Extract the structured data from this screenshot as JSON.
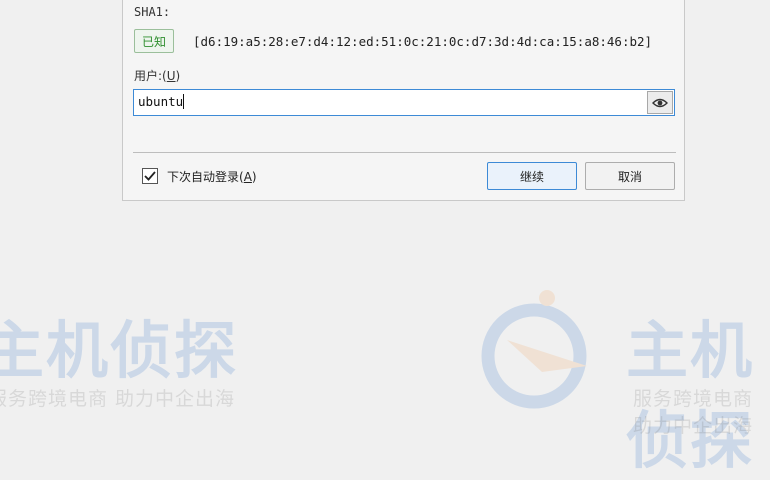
{
  "dialog": {
    "sha1_label": "SHA1:",
    "known_badge": "已知",
    "fingerprint": "[d6:19:a5:28:e7:d4:12:ed:51:0c:21:0c:d7:3d:4d:ca:15:a8:46:b2]",
    "user_label_prefix": "用户:(",
    "user_label_key": "U",
    "user_label_suffix": ")",
    "username_value": "ubuntu",
    "auto_login_prefix": "下次自动登录(",
    "auto_login_key": "A",
    "auto_login_suffix": ")",
    "auto_login_checked": true,
    "continue_button": "继续",
    "cancel_button": "取消"
  },
  "watermark": {
    "brand": "主机侦探",
    "slogan": "服务跨境电商 助力中企出海"
  },
  "colors": {
    "accent": "#3d8ad6",
    "known_green": "#2f8f2f",
    "watermark_blue": "#2d72c8",
    "watermark_orange": "#f0a35b"
  }
}
